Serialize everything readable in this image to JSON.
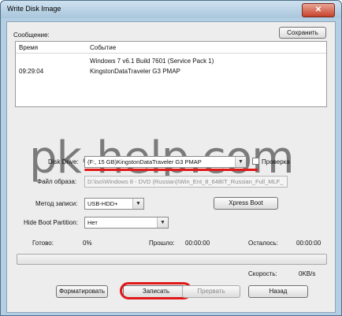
{
  "window": {
    "title": "Write Disk Image",
    "close_glyph": "✕"
  },
  "log": {
    "section_label": "Сообщение:",
    "save_button": "Сохранить",
    "columns": [
      "Время",
      "Событие"
    ],
    "rows": [
      {
        "time": "",
        "event": "Windows 7 v6.1 Build 7601 (Service Pack 1)"
      },
      {
        "time": "09:29:04",
        "event": "KingstonDataTraveler G3 PMAP"
      }
    ]
  },
  "watermark": "pk-help.com",
  "disk_drive": {
    "label": "Disk Drive:",
    "value": "(F:, 15 GB)KingstonDataTraveler G3 PMAP"
  },
  "verify": {
    "label": "Проверка",
    "checked": false
  },
  "image_file": {
    "label": "Файл образа:",
    "value": "D:\\iso\\Windows 8 - DVD (Russian)\\Win_Ent_8_64BIT_Russian_Full_MLF_"
  },
  "write_method": {
    "label": "Метод записи:",
    "value": "USB-HDD+"
  },
  "xpress_boot": "Xpress Boot",
  "hide_boot": {
    "label": "Hide Boot Partition:",
    "value": "Нет"
  },
  "status": {
    "done_label": "Готово:",
    "done_value": "0%",
    "elapsed_label": "Прошло:",
    "elapsed_value": "00:00:00",
    "remaining_label": "Осталось:",
    "remaining_value": "00:00:00",
    "speed_label": "Скорость:",
    "speed_value": "0KB/s",
    "progress_fraction": 0
  },
  "buttons": {
    "format": "Форматировать",
    "write": "Записать",
    "abort": "Прервать",
    "back": "Назад"
  },
  "colors": {
    "highlight": "#e01818",
    "window_frame": "#b4cfe3"
  }
}
